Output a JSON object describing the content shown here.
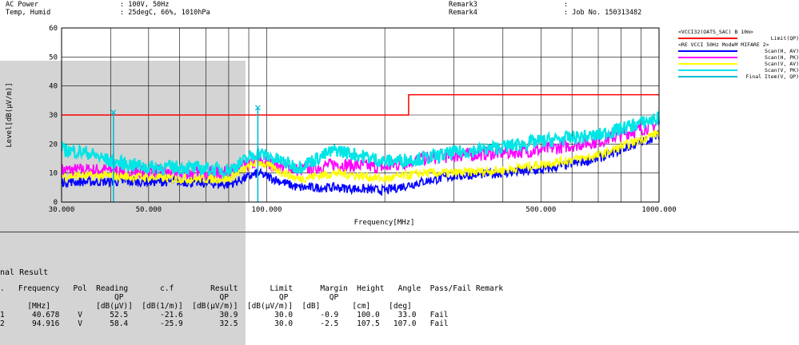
{
  "header": {
    "ac_power_label": "AC Power",
    "ac_power_value": ": 100V, 50Hz",
    "temp_label": "Temp, Humid",
    "temp_value": ": 25degC, 66%, 1010hPa",
    "remark3_label": "Remark3",
    "remark3_value": ":",
    "remark4_label": "Remark4",
    "remark4_value": ": Job No. 150313482"
  },
  "legend": {
    "title1": "<VCCI32(OATS_SAC) B 10m>",
    "limit_label": "Limit(QP)",
    "title2": "<RE VCCI 50Hz Mode",
    "title2_suffix": "M MIFARE 2>",
    "items": [
      {
        "label": "Scan(H, AV)",
        "color": "#0000ff"
      },
      {
        "label": "Scan(H, PK)",
        "color": "#ff00ff"
      },
      {
        "label": "Scan(V, AV)",
        "color": "#ffff00"
      },
      {
        "label": "Scan(V, PK)",
        "color": "#00e5e5"
      },
      {
        "label": "Final Item(V, QP)",
        "color": "#00bcd4"
      }
    ],
    "limit_color": "#ff0000"
  },
  "chart_data": {
    "type": "line",
    "xlabel": "Frequency[MHz]",
    "ylabel": "Level[dB(μV/m)]",
    "xscale": "log",
    "xlim": [
      30,
      1000
    ],
    "ylim": [
      0,
      60
    ],
    "x_tick_labels": [
      "30.000",
      "50.000",
      "100.000",
      "500.000",
      "1000.000"
    ],
    "y_tick_labels": [
      "0",
      "10",
      "20",
      "30",
      "40",
      "50",
      "60"
    ],
    "limit": {
      "name": "Limit(QP)",
      "segments": [
        {
          "x": [
            30,
            230
          ],
          "y": 30
        },
        {
          "x": [
            230,
            1000
          ],
          "y": 37
        }
      ]
    },
    "series": [
      {
        "name": "Scan(H, AV)",
        "x": [
          30,
          40,
          60,
          80,
          95,
          120,
          150,
          200,
          250,
          300,
          400,
          500,
          700,
          1000
        ],
        "y": [
          7,
          7,
          7,
          6,
          10,
          5,
          5,
          4,
          7,
          9,
          10,
          11,
          15,
          23
        ]
      },
      {
        "name": "Scan(H, PK)",
        "x": [
          30,
          40,
          60,
          80,
          95,
          120,
          150,
          200,
          250,
          300,
          400,
          500,
          700,
          1000
        ],
        "y": [
          11,
          11,
          10,
          10,
          14,
          11,
          13,
          12,
          15,
          16,
          17,
          18,
          21,
          27
        ]
      },
      {
        "name": "Scan(V, AV)",
        "x": [
          30,
          40,
          60,
          80,
          95,
          120,
          150,
          200,
          250,
          300,
          400,
          500,
          700,
          1000
        ],
        "y": [
          9,
          9,
          8,
          8,
          14,
          8,
          10,
          8,
          10,
          10,
          11,
          13,
          16,
          24
        ]
      },
      {
        "name": "Scan(V, PK)",
        "x": [
          30,
          35,
          40,
          50,
          60,
          80,
          95,
          120,
          150,
          200,
          250,
          300,
          400,
          500,
          700,
          1000
        ],
        "y": [
          18,
          17,
          14,
          12,
          12,
          11,
          17,
          12,
          18,
          14,
          15,
          17,
          19,
          21,
          23,
          29
        ]
      },
      {
        "name": "Final Item(V, QP)",
        "x": [
          40.678,
          94.916
        ],
        "y": [
          30.9,
          32.5
        ]
      }
    ]
  },
  "result": {
    "title": "nal Result",
    "header_row1": ".   Frequency   Pol  Reading       c.f        Result       Limit      Margin  Height   Angle  Pass/Fail Remark",
    "header_row2": "                         QP                     QP           QP         QP",
    "header_row3": "      [MHz]          [dB(μV)]  [dB(1/m)]  [dB(μV/m)]  [dB(μV/m)]  [dB]       [cm]    [deg]",
    "rows": [
      "1      40.678    V      52.5       -21.6        30.9        30.0      -0.9    100.0    33.0   Fail",
      "2      94.916    V      58.4       -25.9        32.5        30.0      -2.5    107.5   107.0   Fail"
    ]
  }
}
